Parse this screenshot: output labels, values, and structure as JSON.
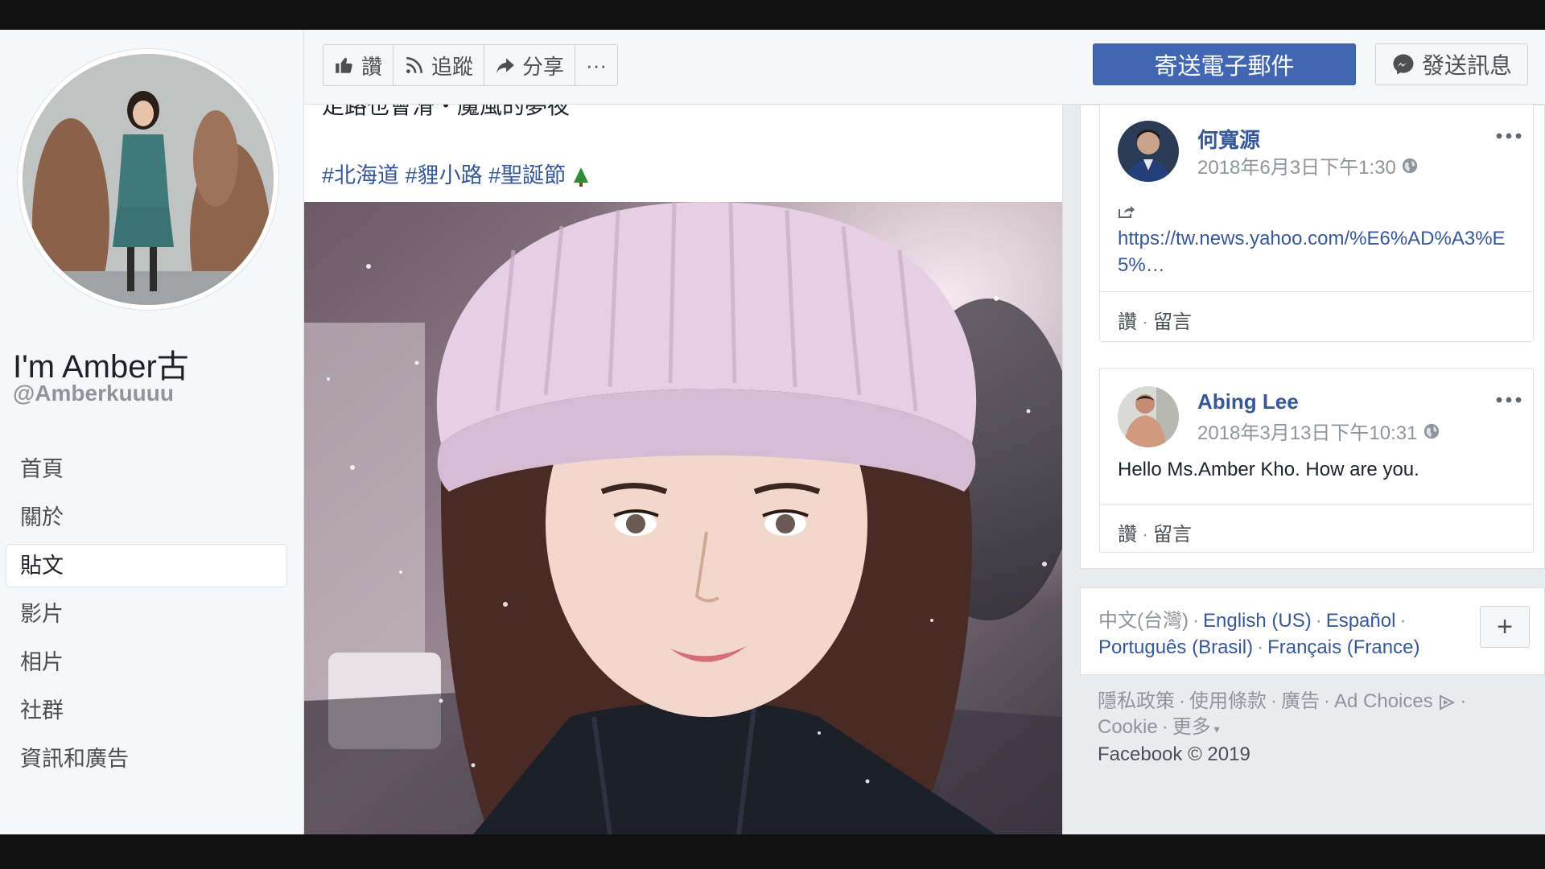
{
  "page": {
    "name": "I'm Amber古",
    "handle": "@Amberkuuuu"
  },
  "nav": {
    "items": [
      {
        "label": "首頁"
      },
      {
        "label": "關於"
      },
      {
        "label": "貼文",
        "active": true
      },
      {
        "label": "影片"
      },
      {
        "label": "相片"
      },
      {
        "label": "社群"
      },
      {
        "label": "資訊和廣告"
      }
    ]
  },
  "actions": {
    "like": "讚",
    "follow": "追蹤",
    "share": "分享",
    "more": "···",
    "email": "寄送電子郵件",
    "message": "發送訊息"
  },
  "post": {
    "text_partial": "走路也會滑・魔風的夢夜",
    "tags": [
      "#北海道",
      "#貍小路",
      "#聖誕節"
    ]
  },
  "reviews": [
    {
      "name": "何寬源",
      "time": "2018年6月3日下午1:30",
      "link": "https://tw.news.yahoo.com/%E6%AD%A3%E5%…",
      "like": "讚",
      "comment": "留言"
    },
    {
      "name": "Abing Lee",
      "time": "2018年3月13日下午10:31",
      "text": "Hello Ms.Amber Kho. How are you.",
      "like": "讚",
      "comment": "留言"
    }
  ],
  "languages": {
    "current": "中文(台灣)",
    "others": [
      "English (US)",
      "Español",
      "Português (Brasil)",
      "Français (France)"
    ],
    "plus": "+"
  },
  "footer": {
    "privacy": "隱私政策",
    "terms": "使用條款",
    "ads": "廣告",
    "ad_choices": "Ad Choices",
    "cookie": "Cookie",
    "more": "更多",
    "copyright": "Facebook © 2019"
  },
  "colors": {
    "accent": "#4267b2",
    "link": "#365899",
    "muted": "#90949c",
    "page_bg": "#e9ebee"
  }
}
